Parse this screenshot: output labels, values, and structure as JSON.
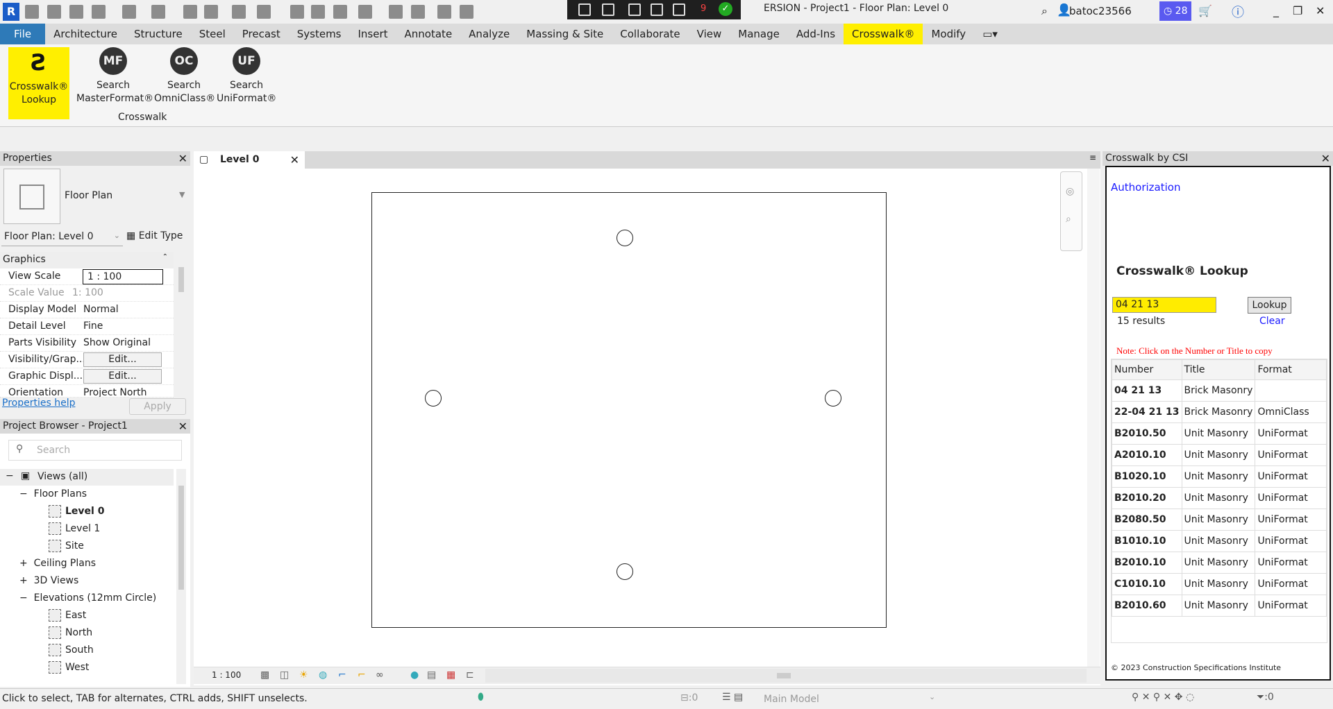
{
  "app": {
    "logo": "R",
    "title": "ERSION - Project1 - Floor Plan: Level 0",
    "user": "batoc23566",
    "notifications": "28",
    "record_count": "9"
  },
  "tabs": [
    "File",
    "Architecture",
    "Structure",
    "Steel",
    "Precast",
    "Systems",
    "Insert",
    "Annotate",
    "Analyze",
    "Massing & Site",
    "Collaborate",
    "View",
    "Manage",
    "Add-Ins",
    "Crosswalk®",
    "Modify"
  ],
  "ribbon": {
    "panel_label": "Crosswalk",
    "buttons": [
      {
        "icon": "crosswalk-logo",
        "line1": "Crosswalk®",
        "line2": "Lookup"
      },
      {
        "icon": "MF",
        "line1": "Search",
        "line2": "MasterFormat®"
      },
      {
        "icon": "OC",
        "line1": "Search",
        "line2": "OmniClass®"
      },
      {
        "icon": "UF",
        "line1": "Search",
        "line2": "UniFormat®"
      }
    ]
  },
  "properties": {
    "title": "Properties",
    "type": "Floor Plan",
    "selector": "Floor Plan: Level 0",
    "edit_type": "Edit Type",
    "group": "Graphics",
    "rows": [
      {
        "k": "View Scale",
        "v": "1 : 100"
      },
      {
        "k": "Scale Value",
        "v": "1: 100"
      },
      {
        "k": "Display Model",
        "v": "Normal"
      },
      {
        "k": "Detail Level",
        "v": "Fine"
      },
      {
        "k": "Parts Visibility",
        "v": "Show Original"
      },
      {
        "k": "Visibility/Grap...",
        "v": "Edit..."
      },
      {
        "k": "Graphic Displ...",
        "v": "Edit..."
      },
      {
        "k": "Orientation",
        "v": "Project North"
      }
    ],
    "help": "Properties help",
    "apply": "Apply"
  },
  "browser": {
    "title": "Project Browser - Project1",
    "search_placeholder": "Search",
    "root": "Views (all)",
    "floor_plans": "Floor Plans",
    "floor_items": [
      "Level 0",
      "Level 1",
      "Site"
    ],
    "ceiling": "Ceiling Plans",
    "views3d": "3D Views",
    "elevations": "Elevations (12mm Circle)",
    "elev_items": [
      "East",
      "North",
      "South",
      "West"
    ]
  },
  "view": {
    "tab": "Level 0",
    "scale": "1 : 100"
  },
  "crosswalk": {
    "title": "Crosswalk by CSI",
    "auth": "Authorization",
    "heading": "Crosswalk® Lookup",
    "query": "04 21 13",
    "lookup": "Lookup",
    "results": "15 results",
    "clear": "Clear",
    "note": "Note: Click on the Number or Title to copy",
    "columns": [
      "Number",
      "Title",
      "Format"
    ],
    "rows": [
      [
        "04 21 13",
        "Brick Masonry",
        ""
      ],
      [
        "22-04 21 13",
        "Brick Masonry",
        "OmniClass"
      ],
      [
        "B2010.50",
        "Unit Masonry",
        "UniFormat"
      ],
      [
        "A2010.10",
        "Unit Masonry",
        "UniFormat"
      ],
      [
        "B1020.10",
        "Unit Masonry",
        "UniFormat"
      ],
      [
        "B2010.20",
        "Unit Masonry",
        "UniFormat"
      ],
      [
        "B2080.50",
        "Unit Masonry",
        "UniFormat"
      ],
      [
        "B1010.10",
        "Unit Masonry",
        "UniFormat"
      ],
      [
        "B2010.10",
        "Unit Masonry",
        "UniFormat"
      ],
      [
        "C1010.10",
        "Unit Masonry",
        "UniFormat"
      ],
      [
        "B2010.60",
        "Unit Masonry",
        "UniFormat"
      ]
    ],
    "copyright": "© 2023 Construction Specifications Institute"
  },
  "status": {
    "hint": "Click to select, TAB for alternates, CTRL adds, SHIFT unselects.",
    "model": "Main Model",
    "sel_count": ":0",
    "filter_count": ":0"
  }
}
